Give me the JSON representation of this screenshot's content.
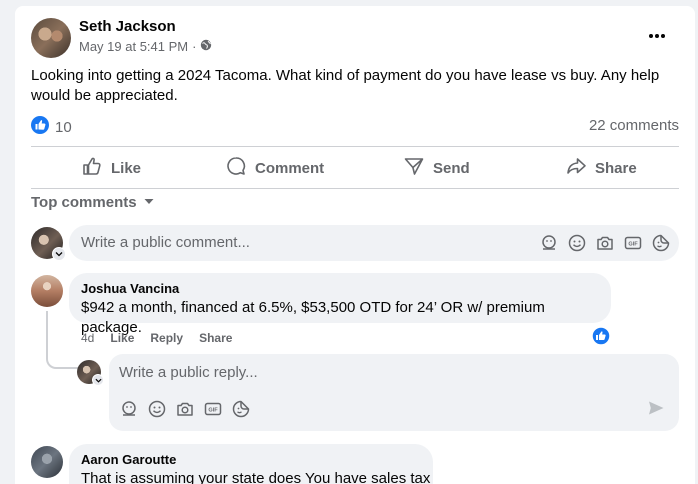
{
  "post": {
    "author": "Seth Jackson",
    "timestamp": "May 19 at 5:41 PM",
    "separator": "·",
    "text": "Looking into getting a 2024 Tacoma. What kind of payment do you have lease vs buy. Any help would be appreciated.",
    "like_count": "10",
    "comment_count": "22 comments",
    "more_icon": "more-options-icon"
  },
  "actions": {
    "like": "Like",
    "comment": "Comment",
    "send": "Send",
    "share": "Share"
  },
  "comments_header": {
    "label": "Top comments"
  },
  "composer": {
    "placeholder": "Write a public comment..."
  },
  "comments": [
    {
      "author": "Joshua Vancina",
      "text": "$942 a month, financed at 6.5%, $53,500 OTD for 24’ OR w/ premium package.",
      "time": "4d",
      "like": "Like",
      "reply": "Reply",
      "share": "Share"
    },
    {
      "author": "Aaron Garoutte",
      "text": "That is assuming your state does You have sales tax"
    }
  ],
  "reply_composer": {
    "placeholder": "Write a public reply..."
  },
  "colors": {
    "accent": "#1877f2",
    "secondary_text": "#65676b",
    "input_bg": "#f0f2f5"
  }
}
